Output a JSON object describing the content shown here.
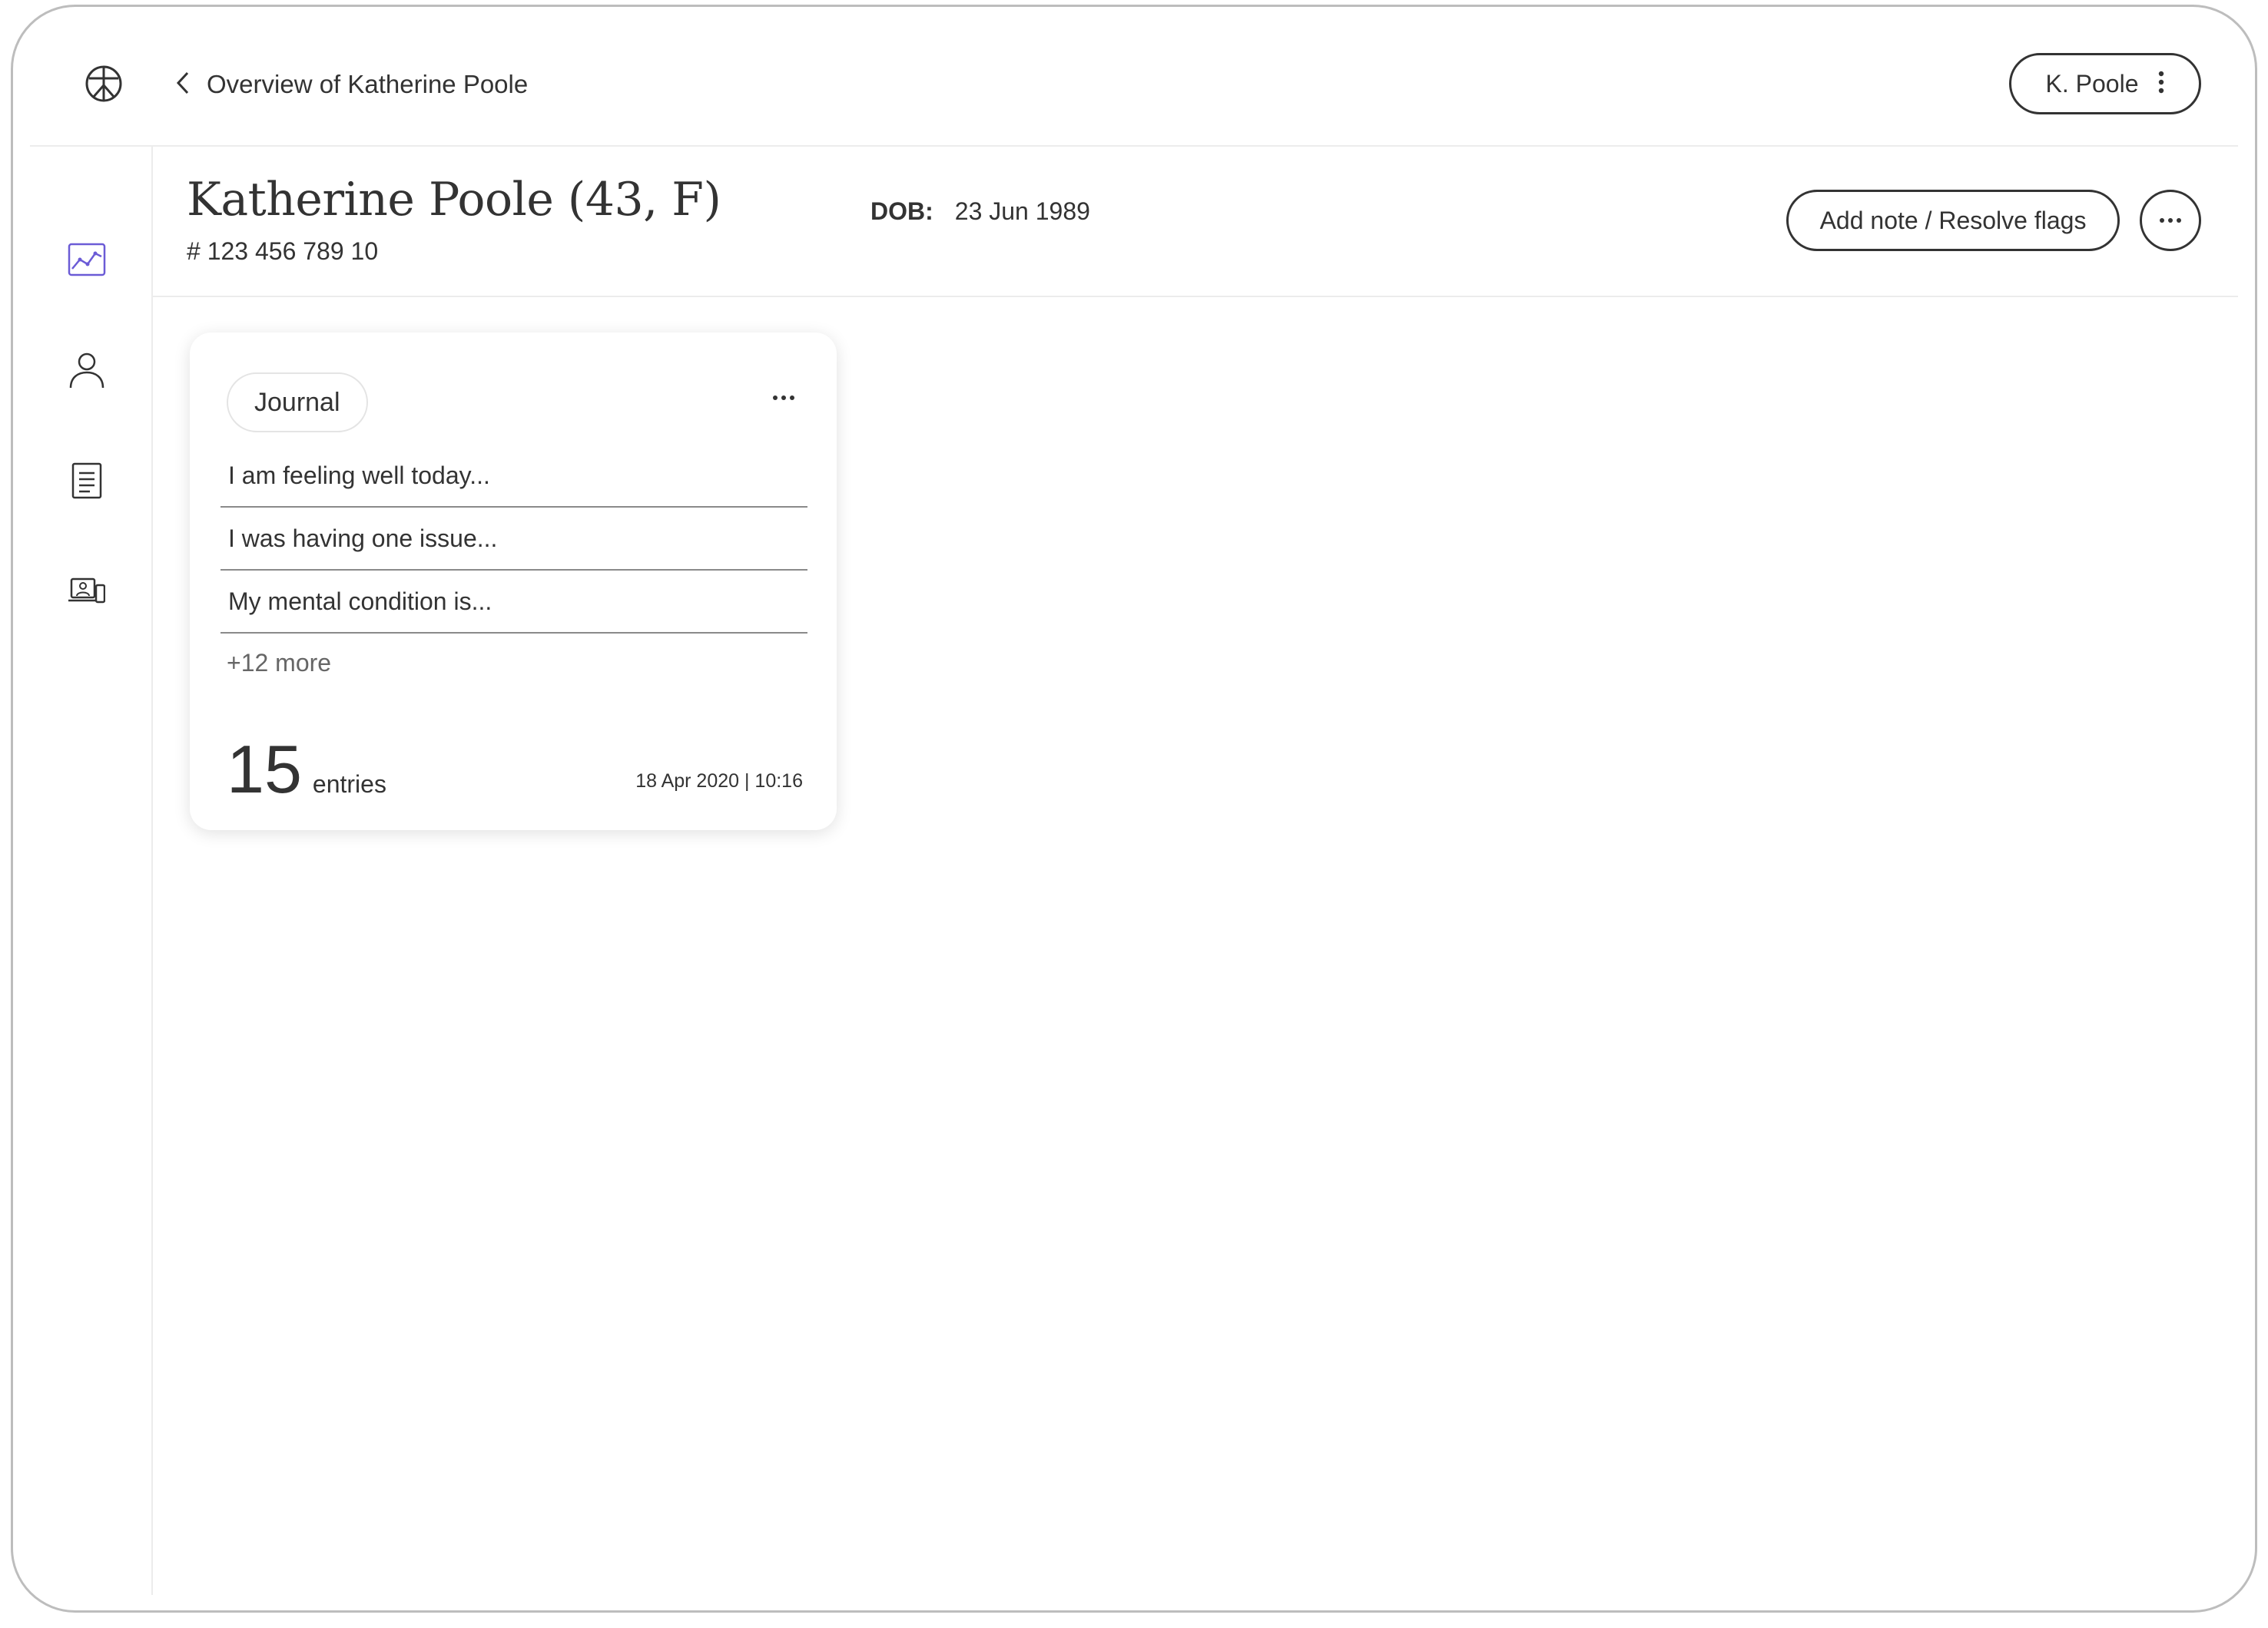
{
  "topbar": {
    "back_label": "Overview of Katherine Poole",
    "user_label": "K. Poole"
  },
  "sidebar": {
    "items": [
      {
        "icon": "chart-icon",
        "active": true
      },
      {
        "icon": "person-icon",
        "active": false
      },
      {
        "icon": "document-icon",
        "active": false
      },
      {
        "icon": "devices-icon",
        "active": false
      }
    ]
  },
  "patient": {
    "name": "Katherine Poole (43, F)",
    "id": "# 123 456 789 10",
    "dob_label": "DOB:",
    "dob_value": "23 Jun 1989"
  },
  "actions": {
    "add_note_label": "Add note / Resolve flags"
  },
  "journal_card": {
    "tag": "Journal",
    "entries": [
      "I am feeling well today...",
      "I was having one issue...",
      "My mental condition is..."
    ],
    "more_label": "+12 more",
    "count": "15",
    "count_unit": "entries",
    "timestamp": "18 Apr 2020 | 10:16"
  },
  "colors": {
    "accent": "#6b5bd6",
    "text": "#333333",
    "divider": "#ececec"
  }
}
